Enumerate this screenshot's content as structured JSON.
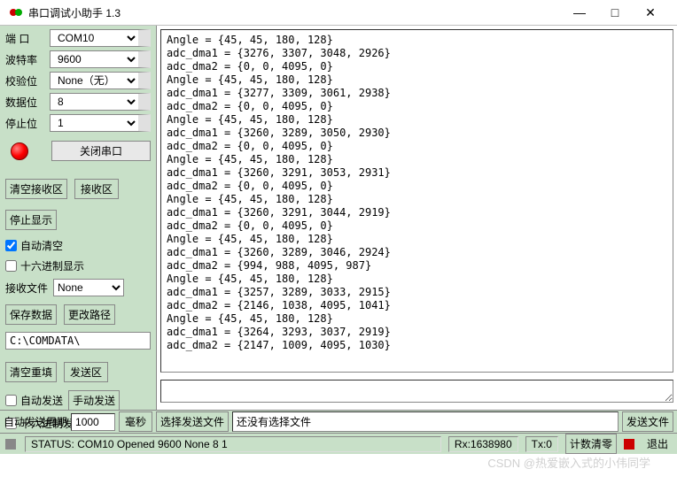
{
  "window": {
    "title": "串口调试小助手 1.3",
    "min": "—",
    "max": "□",
    "close": "✕"
  },
  "config": {
    "port_label": "端  口",
    "port_value": "COM10",
    "baud_label": "波特率",
    "baud_value": "9600",
    "parity_label": "校验位",
    "parity_value": "None（无）",
    "databits_label": "数据位",
    "databits_value": "8",
    "stopbits_label": "停止位",
    "stopbits_value": "1",
    "close_port_btn": "关闭串口"
  },
  "rx": {
    "clear_btn": "清空接收区",
    "area_label": "接收区",
    "stop_btn": "停止显示",
    "auto_clear": "自动清空",
    "hex_disp": "十六进制显示",
    "rx_file_label": "接收文件",
    "rx_file_value": "None",
    "save_btn": "保存数据",
    "path_btn": "更改路径",
    "path_value": "C:\\COMDATA\\"
  },
  "tx": {
    "clear_btn": "清空重填",
    "area_label": "发送区",
    "auto_send": "自动发送",
    "manual_btn": "手动发送",
    "hex_send": "十六进制发送"
  },
  "bottom": {
    "period_label": "自动发送周期",
    "period_value": "1000",
    "ms_label": "毫秒",
    "select_file_btn": "选择发送文件",
    "no_file": "还没有选择文件",
    "send_file_btn": "发送文件"
  },
  "status": {
    "status_text": "STATUS: COM10 Opened 9600 None  8 1",
    "rx_text": "Rx:1638980",
    "tx_text": "Tx:0",
    "cnt_clear": "计数清零",
    "exit": "退出"
  },
  "rx_data": "Angle = {45, 45, 180, 128}\nadc_dma1 = {3276, 3307, 3048, 2926}\nadc_dma2 = {0, 0, 4095, 0}\nAngle = {45, 45, 180, 128}\nadc_dma1 = {3277, 3309, 3061, 2938}\nadc_dma2 = {0, 0, 4095, 0}\nAngle = {45, 45, 180, 128}\nadc_dma1 = {3260, 3289, 3050, 2930}\nadc_dma2 = {0, 0, 4095, 0}\nAngle = {45, 45, 180, 128}\nadc_dma1 = {3260, 3291, 3053, 2931}\nadc_dma2 = {0, 0, 4095, 0}\nAngle = {45, 45, 180, 128}\nadc_dma1 = {3260, 3291, 3044, 2919}\nadc_dma2 = {0, 0, 4095, 0}\nAngle = {45, 45, 180, 128}\nadc_dma1 = {3260, 3289, 3046, 2924}\nadc_dma2 = {994, 988, 4095, 987}\nAngle = {45, 45, 180, 128}\nadc_dma1 = {3257, 3289, 3033, 2915}\nadc_dma2 = {2146, 1038, 4095, 1041}\nAngle = {45, 45, 180, 128}\nadc_dma1 = {3264, 3293, 3037, 2919}\nadc_dma2 = {2147, 1009, 4095, 1030}",
  "watermark": "CSDN @热爱嵌入式的小伟同学"
}
